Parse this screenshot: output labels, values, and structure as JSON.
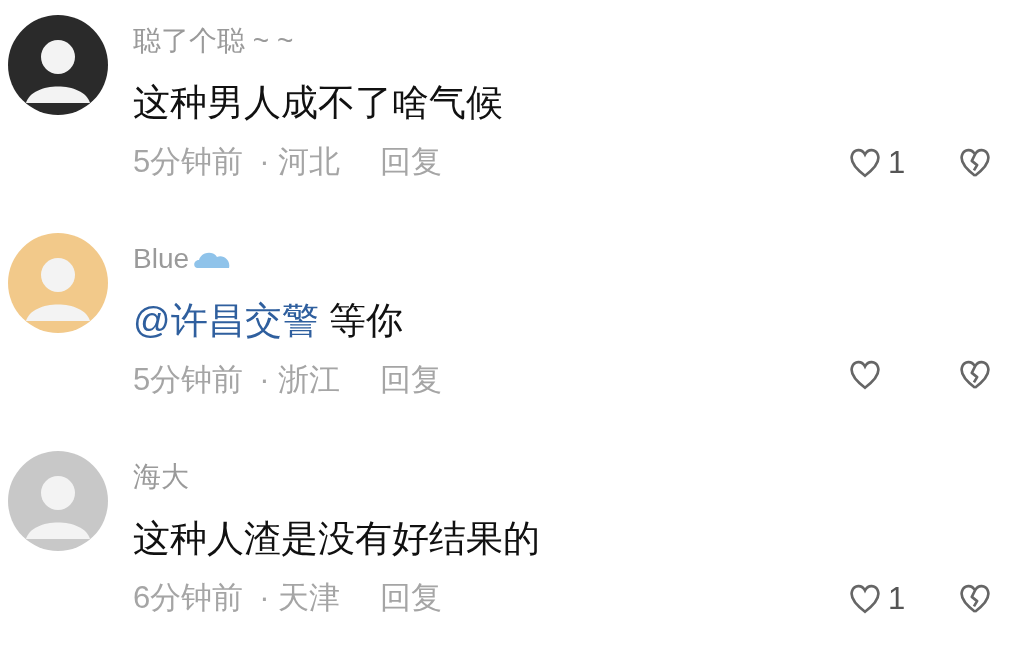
{
  "comments": [
    {
      "name": "聪了个聪 ~ ~",
      "color": "#2a2a2a",
      "text": "这种男人成不了啥气候",
      "time": "5分钟前",
      "location": "· 河北",
      "reply": "回复",
      "likes": "1"
    },
    {
      "name": "Blue",
      "name_icon": true,
      "color": "#f2c98a",
      "mention": "@许昌交警",
      "text": "等你",
      "time": "5分钟前",
      "location": "· 浙江",
      "reply": "回复"
    },
    {
      "name": "海大",
      "color": "#c8c8c8",
      "text": "这种人渣是没有好结果的",
      "time": "6分钟前",
      "location": "· 天津",
      "reply": "回复",
      "likes": "1"
    }
  ]
}
